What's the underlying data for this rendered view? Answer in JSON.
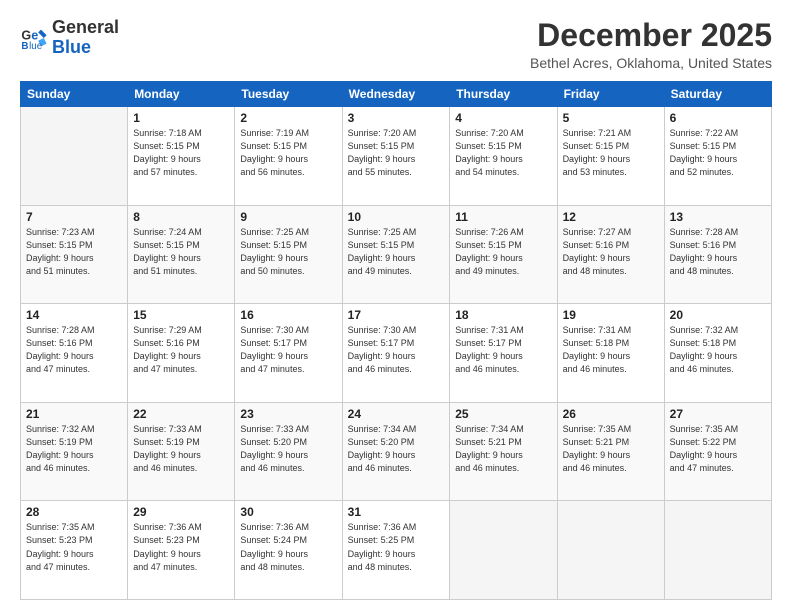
{
  "header": {
    "logo_line1": "General",
    "logo_line2": "Blue",
    "month": "December 2025",
    "location": "Bethel Acres, Oklahoma, United States"
  },
  "days_of_week": [
    "Sunday",
    "Monday",
    "Tuesday",
    "Wednesday",
    "Thursday",
    "Friday",
    "Saturday"
  ],
  "weeks": [
    [
      {
        "day": "",
        "info": ""
      },
      {
        "day": "1",
        "info": "Sunrise: 7:18 AM\nSunset: 5:15 PM\nDaylight: 9 hours\nand 57 minutes."
      },
      {
        "day": "2",
        "info": "Sunrise: 7:19 AM\nSunset: 5:15 PM\nDaylight: 9 hours\nand 56 minutes."
      },
      {
        "day": "3",
        "info": "Sunrise: 7:20 AM\nSunset: 5:15 PM\nDaylight: 9 hours\nand 55 minutes."
      },
      {
        "day": "4",
        "info": "Sunrise: 7:20 AM\nSunset: 5:15 PM\nDaylight: 9 hours\nand 54 minutes."
      },
      {
        "day": "5",
        "info": "Sunrise: 7:21 AM\nSunset: 5:15 PM\nDaylight: 9 hours\nand 53 minutes."
      },
      {
        "day": "6",
        "info": "Sunrise: 7:22 AM\nSunset: 5:15 PM\nDaylight: 9 hours\nand 52 minutes."
      }
    ],
    [
      {
        "day": "7",
        "info": "Sunrise: 7:23 AM\nSunset: 5:15 PM\nDaylight: 9 hours\nand 51 minutes."
      },
      {
        "day": "8",
        "info": "Sunrise: 7:24 AM\nSunset: 5:15 PM\nDaylight: 9 hours\nand 51 minutes."
      },
      {
        "day": "9",
        "info": "Sunrise: 7:25 AM\nSunset: 5:15 PM\nDaylight: 9 hours\nand 50 minutes."
      },
      {
        "day": "10",
        "info": "Sunrise: 7:25 AM\nSunset: 5:15 PM\nDaylight: 9 hours\nand 49 minutes."
      },
      {
        "day": "11",
        "info": "Sunrise: 7:26 AM\nSunset: 5:15 PM\nDaylight: 9 hours\nand 49 minutes."
      },
      {
        "day": "12",
        "info": "Sunrise: 7:27 AM\nSunset: 5:16 PM\nDaylight: 9 hours\nand 48 minutes."
      },
      {
        "day": "13",
        "info": "Sunrise: 7:28 AM\nSunset: 5:16 PM\nDaylight: 9 hours\nand 48 minutes."
      }
    ],
    [
      {
        "day": "14",
        "info": "Sunrise: 7:28 AM\nSunset: 5:16 PM\nDaylight: 9 hours\nand 47 minutes."
      },
      {
        "day": "15",
        "info": "Sunrise: 7:29 AM\nSunset: 5:16 PM\nDaylight: 9 hours\nand 47 minutes."
      },
      {
        "day": "16",
        "info": "Sunrise: 7:30 AM\nSunset: 5:17 PM\nDaylight: 9 hours\nand 47 minutes."
      },
      {
        "day": "17",
        "info": "Sunrise: 7:30 AM\nSunset: 5:17 PM\nDaylight: 9 hours\nand 46 minutes."
      },
      {
        "day": "18",
        "info": "Sunrise: 7:31 AM\nSunset: 5:17 PM\nDaylight: 9 hours\nand 46 minutes."
      },
      {
        "day": "19",
        "info": "Sunrise: 7:31 AM\nSunset: 5:18 PM\nDaylight: 9 hours\nand 46 minutes."
      },
      {
        "day": "20",
        "info": "Sunrise: 7:32 AM\nSunset: 5:18 PM\nDaylight: 9 hours\nand 46 minutes."
      }
    ],
    [
      {
        "day": "21",
        "info": "Sunrise: 7:32 AM\nSunset: 5:19 PM\nDaylight: 9 hours\nand 46 minutes."
      },
      {
        "day": "22",
        "info": "Sunrise: 7:33 AM\nSunset: 5:19 PM\nDaylight: 9 hours\nand 46 minutes."
      },
      {
        "day": "23",
        "info": "Sunrise: 7:33 AM\nSunset: 5:20 PM\nDaylight: 9 hours\nand 46 minutes."
      },
      {
        "day": "24",
        "info": "Sunrise: 7:34 AM\nSunset: 5:20 PM\nDaylight: 9 hours\nand 46 minutes."
      },
      {
        "day": "25",
        "info": "Sunrise: 7:34 AM\nSunset: 5:21 PM\nDaylight: 9 hours\nand 46 minutes."
      },
      {
        "day": "26",
        "info": "Sunrise: 7:35 AM\nSunset: 5:21 PM\nDaylight: 9 hours\nand 46 minutes."
      },
      {
        "day": "27",
        "info": "Sunrise: 7:35 AM\nSunset: 5:22 PM\nDaylight: 9 hours\nand 47 minutes."
      }
    ],
    [
      {
        "day": "28",
        "info": "Sunrise: 7:35 AM\nSunset: 5:23 PM\nDaylight: 9 hours\nand 47 minutes."
      },
      {
        "day": "29",
        "info": "Sunrise: 7:36 AM\nSunset: 5:23 PM\nDaylight: 9 hours\nand 47 minutes."
      },
      {
        "day": "30",
        "info": "Sunrise: 7:36 AM\nSunset: 5:24 PM\nDaylight: 9 hours\nand 48 minutes."
      },
      {
        "day": "31",
        "info": "Sunrise: 7:36 AM\nSunset: 5:25 PM\nDaylight: 9 hours\nand 48 minutes."
      },
      {
        "day": "",
        "info": ""
      },
      {
        "day": "",
        "info": ""
      },
      {
        "day": "",
        "info": ""
      }
    ]
  ]
}
